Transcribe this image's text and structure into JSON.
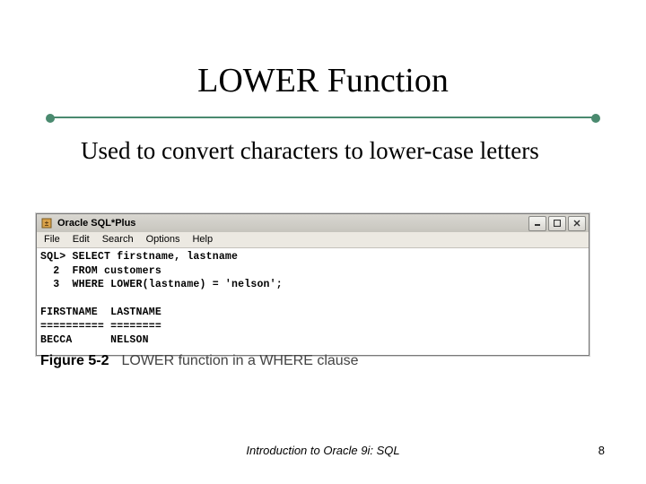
{
  "slide": {
    "title": "LOWER Function",
    "body": "Used to convert characters to lower-case letters"
  },
  "window": {
    "title": "Oracle SQL*Plus",
    "menu": [
      "File",
      "Edit",
      "Search",
      "Options",
      "Help"
    ],
    "console_lines": [
      "SQL> SELECT firstname, lastname",
      "  2  FROM customers",
      "  3  WHERE LOWER(lastname) = 'nelson';",
      "",
      "FIRSTNAME  LASTNAME",
      "========== ========",
      "BECCA      NELSON"
    ]
  },
  "figure": {
    "label": "Figure 5-2",
    "caption": "LOWER function in a WHERE clause"
  },
  "footer": {
    "center": "Introduction to Oracle 9i: SQL",
    "page": "8"
  }
}
